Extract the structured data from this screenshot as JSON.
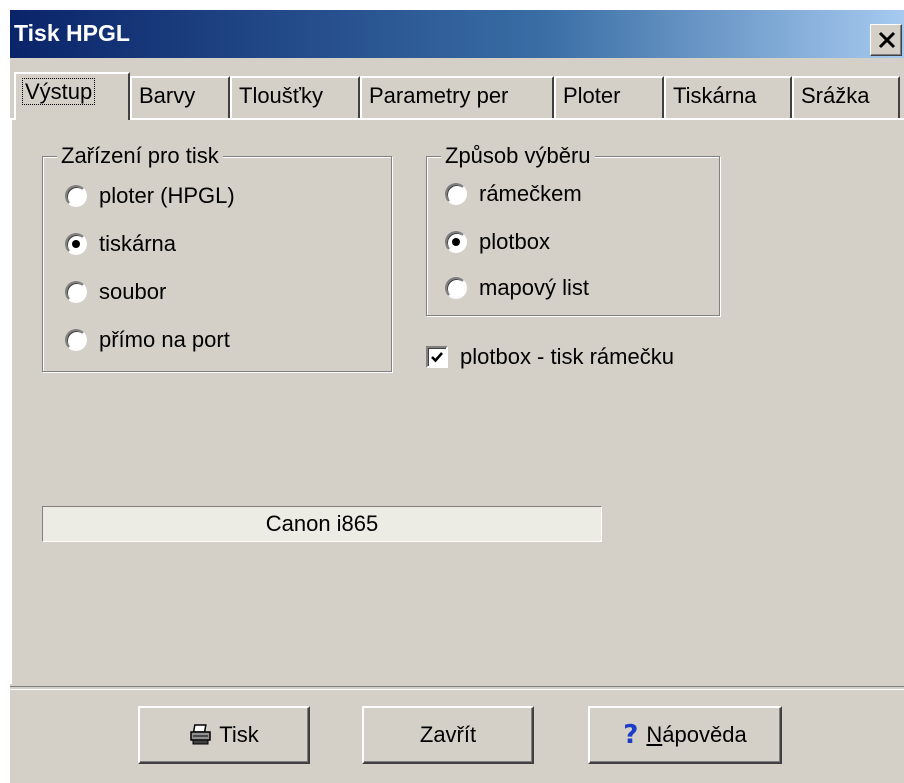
{
  "window": {
    "title": "Tisk HPGL"
  },
  "tabs": [
    {
      "label": "Výstup",
      "active": true
    },
    {
      "label": "Barvy",
      "active": false
    },
    {
      "label": "Tloušťky",
      "active": false
    },
    {
      "label": "Parametry per",
      "active": false
    },
    {
      "label": "Ploter",
      "active": false
    },
    {
      "label": "Tiskárna",
      "active": false
    },
    {
      "label": "Srážka",
      "active": false
    }
  ],
  "device_group": {
    "title": "Zařízení pro tisk",
    "options": [
      {
        "label": "ploter (HPGL)",
        "selected": false
      },
      {
        "label": "tiskárna",
        "selected": true
      },
      {
        "label": "soubor",
        "selected": false
      },
      {
        "label": "přímo na port",
        "selected": false
      }
    ]
  },
  "selection_group": {
    "title": "Způsob výběru",
    "options": [
      {
        "label": "rámečkem",
        "selected": false
      },
      {
        "label": "plotbox",
        "selected": true
      },
      {
        "label": "mapový list",
        "selected": false
      }
    ]
  },
  "plotbox_frame": {
    "label": "plotbox - tisk rámečku",
    "checked": true
  },
  "printer_name": "Canon i865",
  "buttons": {
    "print": "Tisk",
    "close": "Zavřít",
    "help": "Nápověda"
  },
  "icons": {
    "close": "close-icon",
    "print": "printer-icon",
    "help": "question-mark-icon",
    "check": "checkmark-icon"
  }
}
